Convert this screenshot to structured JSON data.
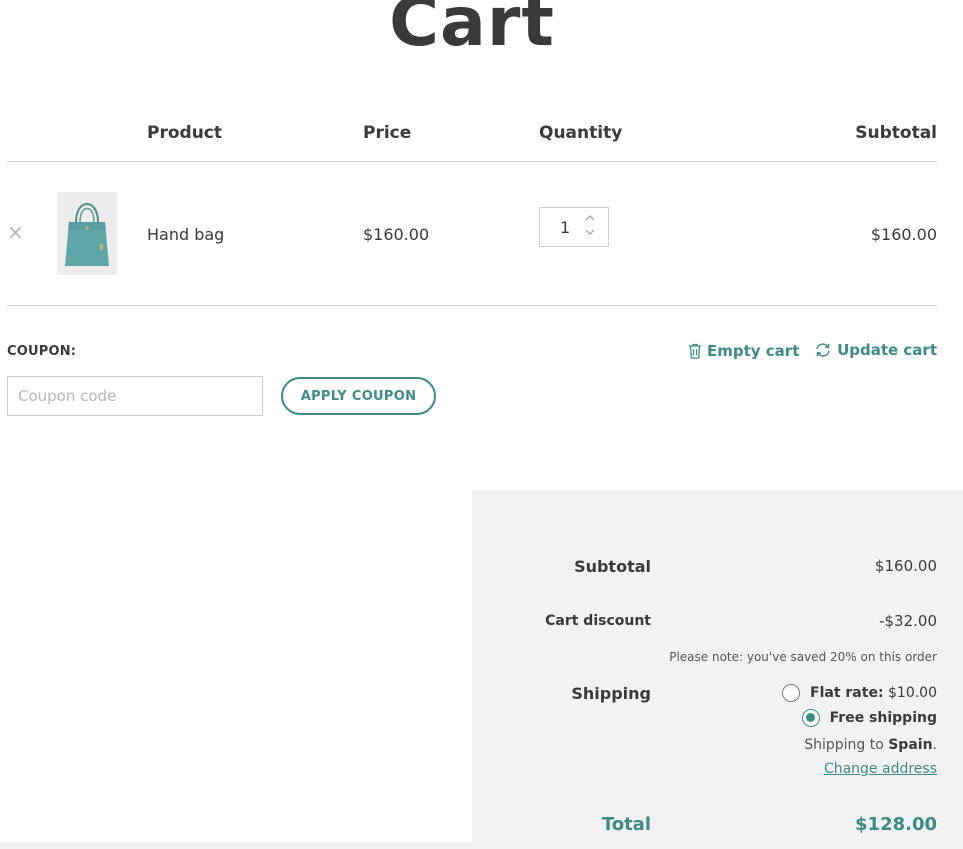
{
  "page": {
    "title": "Cart"
  },
  "table": {
    "headers": {
      "product": "Product",
      "price": "Price",
      "quantity": "Quantity",
      "subtotal": "Subtotal"
    },
    "rows": [
      {
        "remove": "×",
        "name": "Hand bag",
        "price": "$160.00",
        "quantity": "1",
        "subtotal": "$160.00",
        "image": "hand-bag-teal"
      }
    ]
  },
  "coupon": {
    "label": "COUPON:",
    "placeholder": "Coupon code",
    "apply_label": "APPLY COUPON"
  },
  "actions": {
    "empty_cart": "Empty cart",
    "update_cart": "Update cart"
  },
  "totals": {
    "subtotal_label": "Subtotal",
    "subtotal_value": "$160.00",
    "discount_label": "Cart discount",
    "discount_value": "-$32.00",
    "discount_note": "Please note: you've saved 20% on this order",
    "shipping_label": "Shipping",
    "shipping_options": [
      {
        "name": "Flat rate:",
        "price": "$10.00",
        "selected": false
      },
      {
        "name": "Free shipping",
        "price": "",
        "selected": true
      }
    ],
    "shipping_to_prefix": "Shipping to",
    "shipping_country": "Spain",
    "shipping_to_suffix": ".",
    "change_address": "Change address",
    "total_label": "Total",
    "total_value": "$128.00"
  },
  "colors": {
    "accent": "#3d8b84",
    "panel_bg": "#f2f2f2",
    "border": "#cfcfcf"
  }
}
